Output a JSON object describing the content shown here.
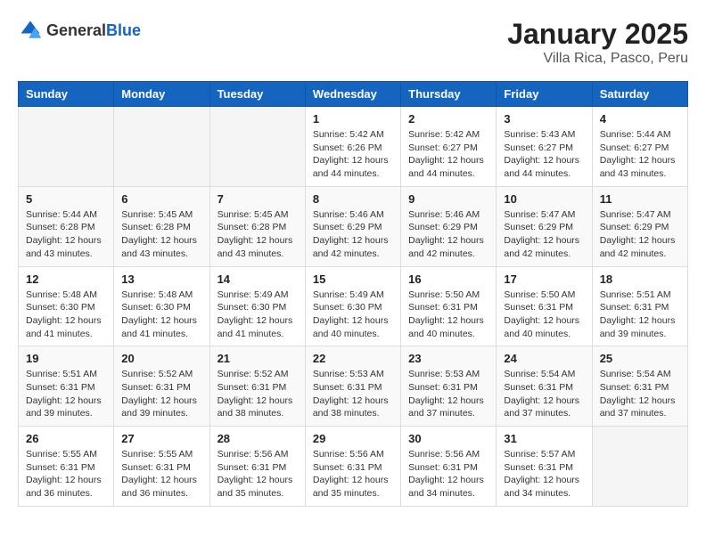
{
  "logo": {
    "general": "General",
    "blue": "Blue"
  },
  "title": "January 2025",
  "subtitle": "Villa Rica, Pasco, Peru",
  "weekdays": [
    "Sunday",
    "Monday",
    "Tuesday",
    "Wednesday",
    "Thursday",
    "Friday",
    "Saturday"
  ],
  "weeks": [
    [
      {
        "day": "",
        "info": ""
      },
      {
        "day": "",
        "info": ""
      },
      {
        "day": "",
        "info": ""
      },
      {
        "day": "1",
        "info": "Sunrise: 5:42 AM\nSunset: 6:26 PM\nDaylight: 12 hours\nand 44 minutes."
      },
      {
        "day": "2",
        "info": "Sunrise: 5:42 AM\nSunset: 6:27 PM\nDaylight: 12 hours\nand 44 minutes."
      },
      {
        "day": "3",
        "info": "Sunrise: 5:43 AM\nSunset: 6:27 PM\nDaylight: 12 hours\nand 44 minutes."
      },
      {
        "day": "4",
        "info": "Sunrise: 5:44 AM\nSunset: 6:27 PM\nDaylight: 12 hours\nand 43 minutes."
      }
    ],
    [
      {
        "day": "5",
        "info": "Sunrise: 5:44 AM\nSunset: 6:28 PM\nDaylight: 12 hours\nand 43 minutes."
      },
      {
        "day": "6",
        "info": "Sunrise: 5:45 AM\nSunset: 6:28 PM\nDaylight: 12 hours\nand 43 minutes."
      },
      {
        "day": "7",
        "info": "Sunrise: 5:45 AM\nSunset: 6:28 PM\nDaylight: 12 hours\nand 43 minutes."
      },
      {
        "day": "8",
        "info": "Sunrise: 5:46 AM\nSunset: 6:29 PM\nDaylight: 12 hours\nand 42 minutes."
      },
      {
        "day": "9",
        "info": "Sunrise: 5:46 AM\nSunset: 6:29 PM\nDaylight: 12 hours\nand 42 minutes."
      },
      {
        "day": "10",
        "info": "Sunrise: 5:47 AM\nSunset: 6:29 PM\nDaylight: 12 hours\nand 42 minutes."
      },
      {
        "day": "11",
        "info": "Sunrise: 5:47 AM\nSunset: 6:29 PM\nDaylight: 12 hours\nand 42 minutes."
      }
    ],
    [
      {
        "day": "12",
        "info": "Sunrise: 5:48 AM\nSunset: 6:30 PM\nDaylight: 12 hours\nand 41 minutes."
      },
      {
        "day": "13",
        "info": "Sunrise: 5:48 AM\nSunset: 6:30 PM\nDaylight: 12 hours\nand 41 minutes."
      },
      {
        "day": "14",
        "info": "Sunrise: 5:49 AM\nSunset: 6:30 PM\nDaylight: 12 hours\nand 41 minutes."
      },
      {
        "day": "15",
        "info": "Sunrise: 5:49 AM\nSunset: 6:30 PM\nDaylight: 12 hours\nand 40 minutes."
      },
      {
        "day": "16",
        "info": "Sunrise: 5:50 AM\nSunset: 6:31 PM\nDaylight: 12 hours\nand 40 minutes."
      },
      {
        "day": "17",
        "info": "Sunrise: 5:50 AM\nSunset: 6:31 PM\nDaylight: 12 hours\nand 40 minutes."
      },
      {
        "day": "18",
        "info": "Sunrise: 5:51 AM\nSunset: 6:31 PM\nDaylight: 12 hours\nand 39 minutes."
      }
    ],
    [
      {
        "day": "19",
        "info": "Sunrise: 5:51 AM\nSunset: 6:31 PM\nDaylight: 12 hours\nand 39 minutes."
      },
      {
        "day": "20",
        "info": "Sunrise: 5:52 AM\nSunset: 6:31 PM\nDaylight: 12 hours\nand 39 minutes."
      },
      {
        "day": "21",
        "info": "Sunrise: 5:52 AM\nSunset: 6:31 PM\nDaylight: 12 hours\nand 38 minutes."
      },
      {
        "day": "22",
        "info": "Sunrise: 5:53 AM\nSunset: 6:31 PM\nDaylight: 12 hours\nand 38 minutes."
      },
      {
        "day": "23",
        "info": "Sunrise: 5:53 AM\nSunset: 6:31 PM\nDaylight: 12 hours\nand 37 minutes."
      },
      {
        "day": "24",
        "info": "Sunrise: 5:54 AM\nSunset: 6:31 PM\nDaylight: 12 hours\nand 37 minutes."
      },
      {
        "day": "25",
        "info": "Sunrise: 5:54 AM\nSunset: 6:31 PM\nDaylight: 12 hours\nand 37 minutes."
      }
    ],
    [
      {
        "day": "26",
        "info": "Sunrise: 5:55 AM\nSunset: 6:31 PM\nDaylight: 12 hours\nand 36 minutes."
      },
      {
        "day": "27",
        "info": "Sunrise: 5:55 AM\nSunset: 6:31 PM\nDaylight: 12 hours\nand 36 minutes."
      },
      {
        "day": "28",
        "info": "Sunrise: 5:56 AM\nSunset: 6:31 PM\nDaylight: 12 hours\nand 35 minutes."
      },
      {
        "day": "29",
        "info": "Sunrise: 5:56 AM\nSunset: 6:31 PM\nDaylight: 12 hours\nand 35 minutes."
      },
      {
        "day": "30",
        "info": "Sunrise: 5:56 AM\nSunset: 6:31 PM\nDaylight: 12 hours\nand 34 minutes."
      },
      {
        "day": "31",
        "info": "Sunrise: 5:57 AM\nSunset: 6:31 PM\nDaylight: 12 hours\nand 34 minutes."
      },
      {
        "day": "",
        "info": ""
      }
    ]
  ]
}
